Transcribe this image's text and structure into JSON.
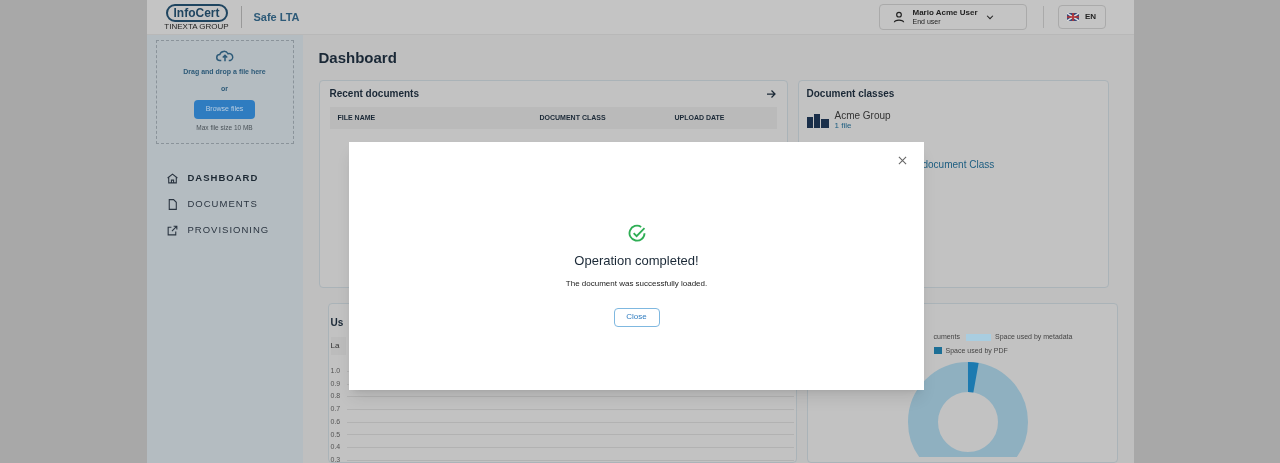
{
  "header": {
    "logo": {
      "name": "InfoCert",
      "group": "TINEXTA GROUP"
    },
    "product": "Safe LTA",
    "user": {
      "name": "Mario Acme User",
      "role": "End user"
    },
    "language": "EN"
  },
  "upload": {
    "prompt": "Drag and drop a file here",
    "or": "or",
    "button": "Browse files",
    "hint": "Max file size 10 MB"
  },
  "nav": [
    {
      "label": "DASHBOARD",
      "selected": true
    },
    {
      "label": "DOCUMENTS",
      "selected": false
    },
    {
      "label": "PROVISIONING",
      "selected": false
    }
  ],
  "page_title": "Dashboard",
  "recent_documents": {
    "title": "Recent documents",
    "columns": [
      "FILE NAME",
      "DOCUMENT CLASS",
      "UPLOAD DATE"
    ]
  },
  "document_classes": {
    "title": "Document classes",
    "items": [
      {
        "name": "Acme Group",
        "count": "1 file"
      }
    ],
    "link": "document Class"
  },
  "usage": {
    "title": "Us",
    "select": "La",
    "y_ticks": [
      "1.0",
      "0.9",
      "0.8",
      "0.7",
      "0.6",
      "0.5",
      "0.4",
      "0.3"
    ]
  },
  "space": {
    "legend": [
      {
        "label": "cuments"
      },
      {
        "label": "Space used by metadata",
        "color": "#a9cde0"
      },
      {
        "label": "Space used by PDF",
        "color": "#1c6f96"
      }
    ]
  },
  "modal": {
    "title": "Operation completed!",
    "message": "The document was successfully loaded.",
    "button": "Close"
  }
}
